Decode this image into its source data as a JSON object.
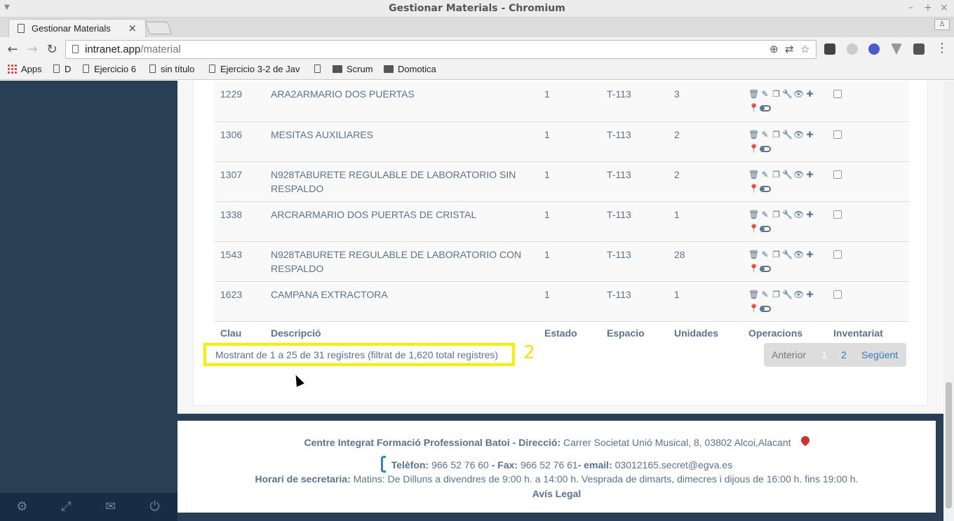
{
  "window": {
    "title": "Gestionar Materials - Chromium"
  },
  "tab": {
    "title": "Gestionar Materials"
  },
  "address": {
    "host": "intranet.app",
    "path": "/material"
  },
  "bookmarks": [
    {
      "label": "Apps",
      "icon": "apps-grid-icon"
    },
    {
      "label": "D",
      "icon": "page-icon"
    },
    {
      "label": "Ejercicio 6",
      "icon": "page-icon"
    },
    {
      "label": "sin título",
      "icon": "page-icon"
    },
    {
      "label": "Ejercicio 3-2 de Jav",
      "icon": "page-icon"
    },
    {
      "label": "",
      "icon": "page-icon"
    },
    {
      "label": "Scrum",
      "icon": "folder-icon"
    },
    {
      "label": "Domotica",
      "icon": "folder-icon"
    }
  ],
  "table": {
    "headers": [
      "Clau",
      "Descripció",
      "Estado",
      "Espacio",
      "Unidades",
      "Operacions",
      "Inventariat"
    ],
    "rows": [
      {
        "clau": "1229",
        "descripcio": "ARA2ARMARIO DOS PUERTAS",
        "estado": "1",
        "espacio": "T-113",
        "unidades": "3"
      },
      {
        "clau": "1306",
        "descripcio": "MESITAS AUXILIARES",
        "estado": "1",
        "espacio": "T-113",
        "unidades": "2"
      },
      {
        "clau": "1307",
        "descripcio": "N928TABURETE REGULABLE DE LABORATORIO SIN RESPALDO",
        "estado": "1",
        "espacio": "T-113",
        "unidades": "2"
      },
      {
        "clau": "1338",
        "descripcio": "ARCRARMARIO DOS PUERTAS DE CRISTAL",
        "estado": "1",
        "espacio": "T-113",
        "unidades": "1"
      },
      {
        "clau": "1543",
        "descripcio": "N928TABURETE REGULABLE DE LABORATORIO CON RESPALDO",
        "estado": "1",
        "espacio": "T-113",
        "unidades": "28"
      },
      {
        "clau": "1623",
        "descripcio": "CAMPANA EXTRACTORA",
        "estado": "1",
        "espacio": "T-113",
        "unidades": "1"
      }
    ]
  },
  "info": {
    "text": "Mostrant de 1 a 25 de 31 registres (filtrat de 1,620 total registres)",
    "annotation": "2"
  },
  "pagination": {
    "prev": "Anterior",
    "page1": "1",
    "page2": "2",
    "next": "Següent"
  },
  "footer": {
    "org_label": "Centre Integrat Formació Professional Batoi - Direcció:",
    "address": "Carrer Societat Unió Musical, 8, 03802 Alcoi,Alacant",
    "phone_label": "Telèfon:",
    "phone": "966 52 76 60",
    "fax_label": "- Fax:",
    "fax": "966 52 76 61",
    "email_label": "- email:",
    "email": "03012165.secret@egva.es",
    "hours_label": "Horari de secretaria:",
    "hours": "Matins: De Dilluns a divendres de 9:00 h. a 14:00 h. Vesprada de dimarts, dimecres i dijous de 16:00 h. fins 19:00 h.",
    "legal": "Avís Legal"
  },
  "colors": {
    "sidebar": "#2a3f54",
    "text": "#5a738e",
    "highlight": "#f4f100",
    "link": "#337ab7"
  }
}
